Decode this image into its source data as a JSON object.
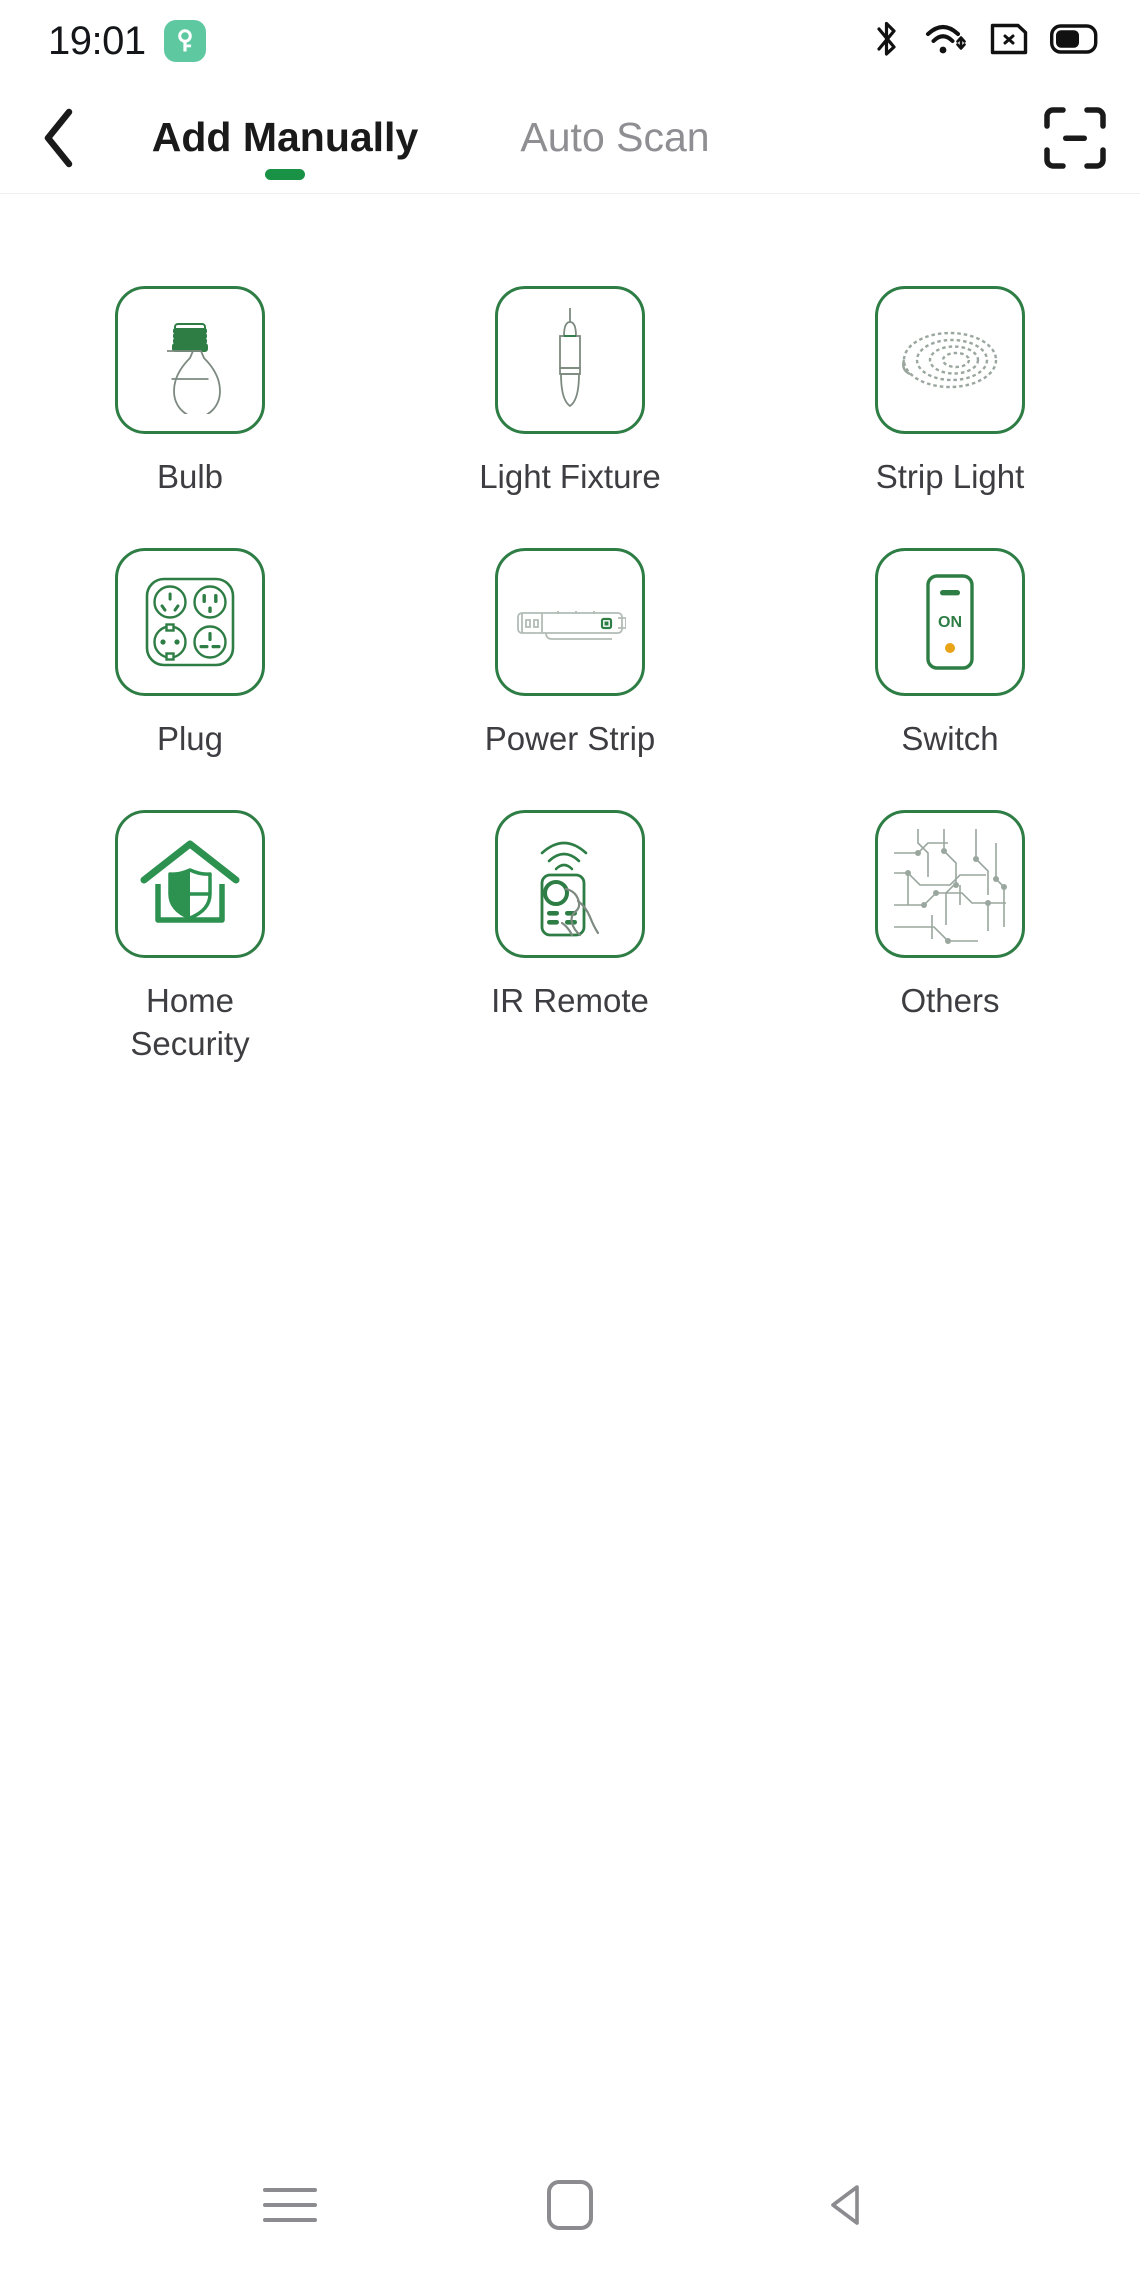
{
  "status_bar": {
    "time": "19:01",
    "badge_icon": "key-icon",
    "badge_color": "#5ec8a0",
    "icons": [
      "bluetooth-icon",
      "wifi-icon",
      "sim-card-icon",
      "battery-icon"
    ]
  },
  "header": {
    "back_icon": "chevron-left-icon",
    "scan_icon": "qr-scan-icon",
    "tabs": [
      {
        "label": "Add Manually",
        "active": true
      },
      {
        "label": "Auto Scan",
        "active": false
      }
    ],
    "active_indicator_color": "#1a9245"
  },
  "accent_color": "#2d7d45",
  "categories": [
    {
      "label": "Bulb",
      "icon": "bulb-icon"
    },
    {
      "label": "Light Fixture",
      "icon": "light-fixture-icon"
    },
    {
      "label": "Strip Light",
      "icon": "strip-light-icon"
    },
    {
      "label": "Plug",
      "icon": "plug-icon"
    },
    {
      "label": "Power Strip",
      "icon": "power-strip-icon"
    },
    {
      "label": "Switch",
      "icon": "switch-icon"
    },
    {
      "label": "Home\nSecurity",
      "icon": "home-security-icon"
    },
    {
      "label": "IR Remote",
      "icon": "ir-remote-icon"
    },
    {
      "label": "Others",
      "icon": "others-icon"
    }
  ],
  "switch_icon_text": "ON",
  "navbar": {
    "buttons": [
      "menu-icon",
      "home-icon",
      "back-triangle-icon"
    ]
  }
}
